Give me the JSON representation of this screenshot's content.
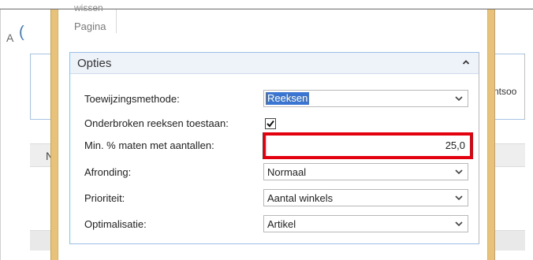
{
  "background": {
    "left_fragment": "A",
    "left_link_fragment": "(",
    "left_row_fragment": "N",
    "right_fragment": "ntsoo"
  },
  "ribbon": {
    "top_line": "wissen",
    "page_label": "Pagina"
  },
  "fasttab": {
    "title": "Opties",
    "collapse_icon": "chevron-up-icon"
  },
  "fields": {
    "assignment_method": {
      "label": "Toewijzingsmethode:",
      "value": "Reeksen"
    },
    "allow_broken_series": {
      "label": "Onderbroken reeksen toestaan:",
      "checked": true
    },
    "min_sizes_pct": {
      "label": "Min. % maten met aantallen:",
      "value": "25,0"
    },
    "rounding": {
      "label": "Afronding:",
      "value": "Normaal"
    },
    "priority": {
      "label": "Prioriteit:",
      "value": "Aantal winkels"
    },
    "optimization": {
      "label": "Optimalisatie:",
      "value": "Artikel"
    }
  },
  "colors": {
    "highlight": "#e3000f",
    "dialog_frame": "#e8c27a",
    "fasttab_border": "#9bbde6",
    "selection": "#3a76d1"
  }
}
